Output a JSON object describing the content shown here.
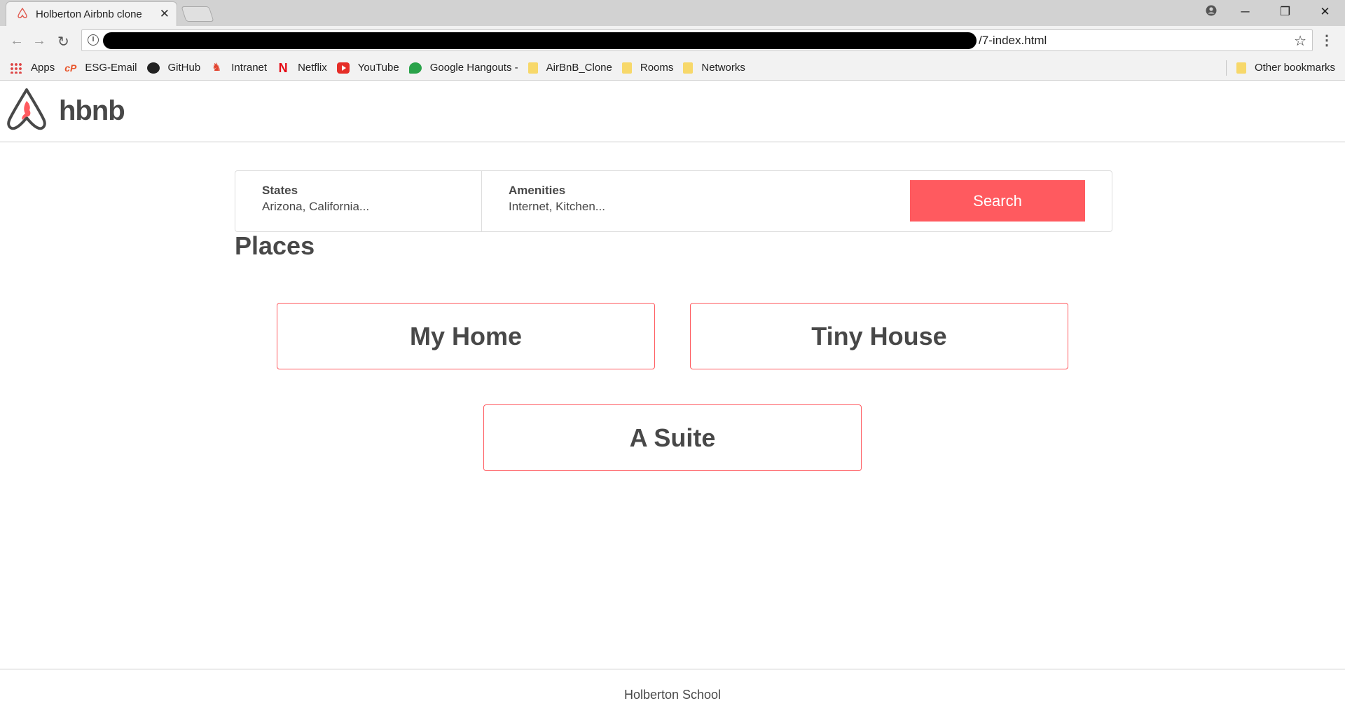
{
  "browser": {
    "tab_title": "Holberton Airbnb clone",
    "url_suffix": "/7-index.html",
    "bookmarks": [
      {
        "label": "Apps",
        "icon": "apps-grid-icon"
      },
      {
        "label": "ESG-Email",
        "icon": "cpanel-icon"
      },
      {
        "label": "GitHub",
        "icon": "github-icon"
      },
      {
        "label": "Intranet",
        "icon": "holberton-icon"
      },
      {
        "label": "Netflix",
        "icon": "netflix-icon"
      },
      {
        "label": "YouTube",
        "icon": "youtube-icon"
      },
      {
        "label": "Google Hangouts - ",
        "icon": "hangouts-icon"
      },
      {
        "label": "AirBnB_Clone",
        "icon": "folder-icon"
      },
      {
        "label": "Rooms",
        "icon": "folder-icon"
      },
      {
        "label": "Networks",
        "icon": "folder-icon"
      }
    ],
    "other_bookmarks": "Other bookmarks"
  },
  "header": {
    "logo_text": "hbnb"
  },
  "filters": {
    "states": {
      "title": "States",
      "value": "Arizona, California..."
    },
    "amenities": {
      "title": "Amenities",
      "value": "Internet, Kitchen..."
    },
    "search_label": "Search"
  },
  "places": {
    "title": "Places",
    "items": [
      {
        "name": "My Home"
      },
      {
        "name": "Tiny House"
      },
      {
        "name": "A Suite"
      }
    ]
  },
  "footer": {
    "text": "Holberton School"
  },
  "colors": {
    "accent": "#ff5a5f",
    "text": "#484848",
    "border": "#cccccc"
  }
}
